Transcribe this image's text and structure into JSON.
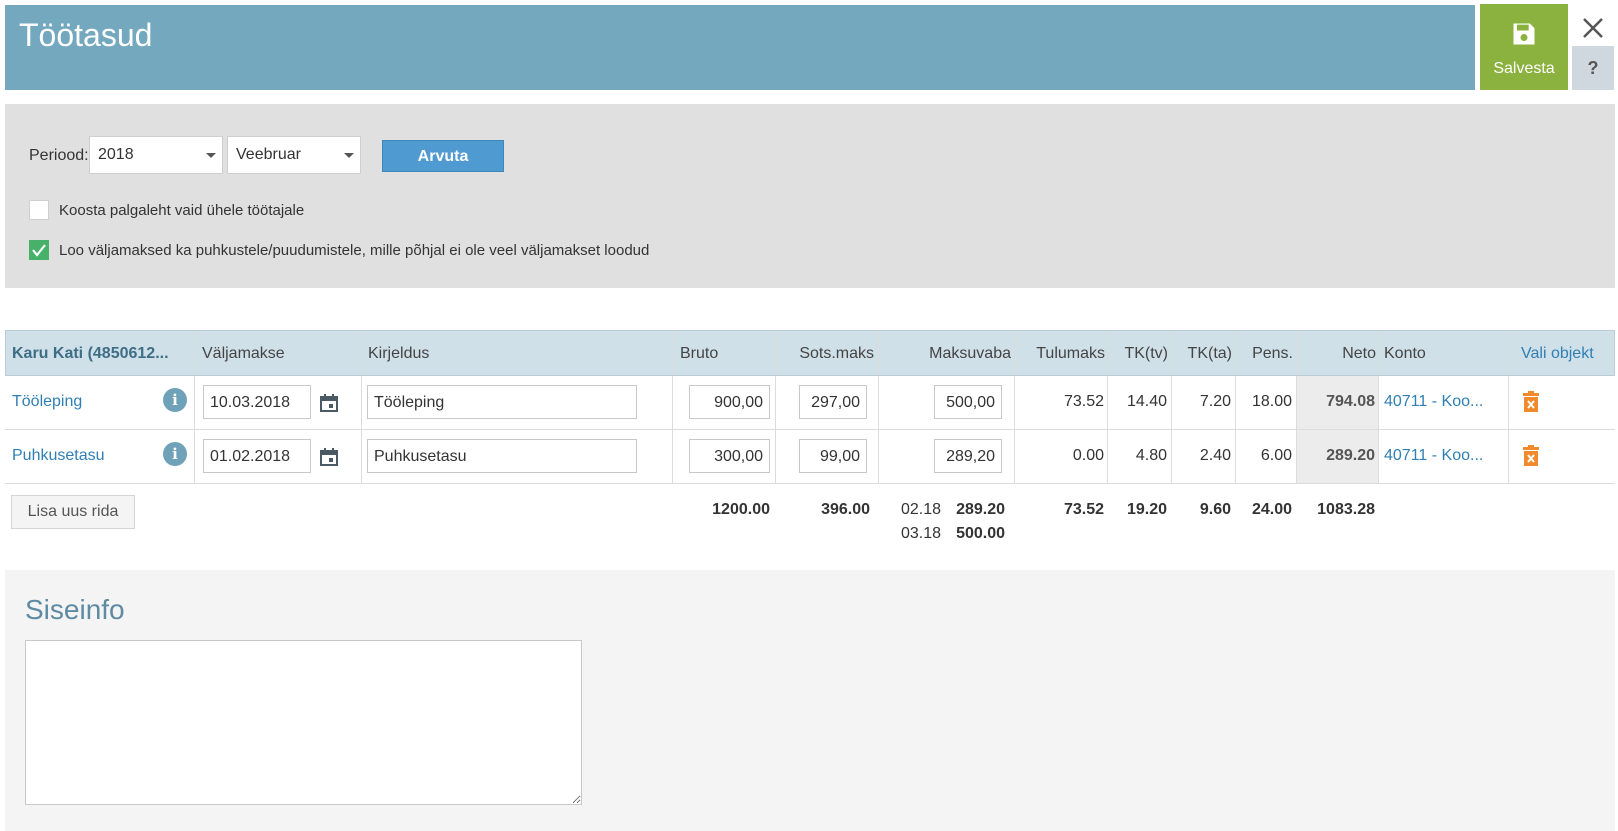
{
  "header": {
    "title": "Töötasud",
    "save_label": "Salvesta",
    "help_label": "?"
  },
  "filters": {
    "period_label": "Periood:",
    "year": "2018",
    "month": "Veebruar",
    "calc_label": "Arvuta",
    "single_employee": {
      "label": "Koosta palgaleht vaid ühele töötajale",
      "checked": false
    },
    "include_vacations": {
      "label": "Loo väljamaksed ka puhkustele/puudumistele, mille põhjal ei ole veel väljamakset loodud",
      "checked": true
    }
  },
  "table": {
    "headers": {
      "employee": "Karu Kati (4850612...",
      "payout": "Väljamakse",
      "description": "Kirjeldus",
      "gross": "Bruto",
      "social": "Sots.maks",
      "tax_free": "Maksuvaba",
      "income_tax": "Tulumaks",
      "tk_tv": "TK(tv)",
      "tk_ta": "TK(ta)",
      "pension": "Pens.",
      "net": "Neto",
      "account": "Konto",
      "select_object": "Vali objekt"
    },
    "rows": [
      {
        "type": "Tööleping",
        "date": "10.03.2018",
        "description": "Tööleping",
        "gross": "900,00",
        "social": "297,00",
        "tax_free": "500,00",
        "income_tax": "73.52",
        "tk_tv": "14.40",
        "tk_ta": "7.20",
        "pension": "18.00",
        "net": "794.08",
        "account": "40711 - Koo..."
      },
      {
        "type": "Puhkusetasu",
        "date": "01.02.2018",
        "description": "Puhkusetasu",
        "gross": "300,00",
        "social": "99,00",
        "tax_free": "289,20",
        "income_tax": "0.00",
        "tk_tv": "4.80",
        "tk_ta": "2.40",
        "pension": "6.00",
        "net": "289.20",
        "account": "40711 - Koo..."
      }
    ],
    "add_row_label": "Lisa uus rida",
    "totals": {
      "gross": "1200.00",
      "social": "396.00",
      "tax_free_1_period": "02.18",
      "tax_free_1_value": "289.20",
      "tax_free_2_period": "03.18",
      "tax_free_2_value": "500.00",
      "income_tax": "73.52",
      "tk_tv": "19.20",
      "tk_ta": "9.60",
      "pension": "24.00",
      "net": "1083.28"
    }
  },
  "info": {
    "title": "Siseinfo",
    "value": ""
  },
  "colors": {
    "header": "#73a8bf",
    "save": "#8bb23e",
    "accent": "#4f9ad0",
    "check": "#47b16a",
    "trash": "#f08a2c"
  }
}
